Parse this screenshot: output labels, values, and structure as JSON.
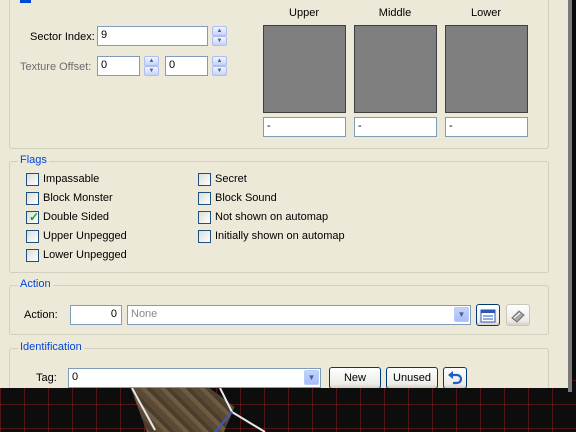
{
  "sector": {
    "index_label": "Sector Index:",
    "index_value": "9",
    "texture_offset_label": "Texture Offset:",
    "offset_x": "0",
    "offset_y": "0"
  },
  "textures": [
    {
      "label": "Upper",
      "value": "-"
    },
    {
      "label": "Middle",
      "value": "-"
    },
    {
      "label": "Lower",
      "value": "-"
    }
  ],
  "flags": {
    "title": "Flags",
    "items": [
      {
        "label": "Impassable",
        "checked": false
      },
      {
        "label": "Block Monster",
        "checked": false
      },
      {
        "label": "Double Sided",
        "checked": true
      },
      {
        "label": "Upper Unpegged",
        "checked": false
      },
      {
        "label": "Lower Unpegged",
        "checked": false
      },
      {
        "label": "Secret",
        "checked": false
      },
      {
        "label": "Block Sound",
        "checked": false
      },
      {
        "label": "Not shown on automap",
        "checked": false
      },
      {
        "label": "Initially shown on automap",
        "checked": false
      }
    ]
  },
  "action": {
    "title": "Action",
    "label": "Action:",
    "value": "0",
    "selected": "None",
    "browse_icon": "list-browse-icon",
    "edit_icon": "edit-script-icon"
  },
  "identification": {
    "title": "Identification",
    "tag_label": "Tag:",
    "tag_value": "0",
    "new_label": "New",
    "unused_label": "Unused",
    "undo_icon": "undo-arrow-icon"
  },
  "colors": {
    "group_title": "#0046d5",
    "dialog_bg": "#ece9d8",
    "texture_preview": "#7f7f7f",
    "map_grid": "#8c1e1e"
  }
}
